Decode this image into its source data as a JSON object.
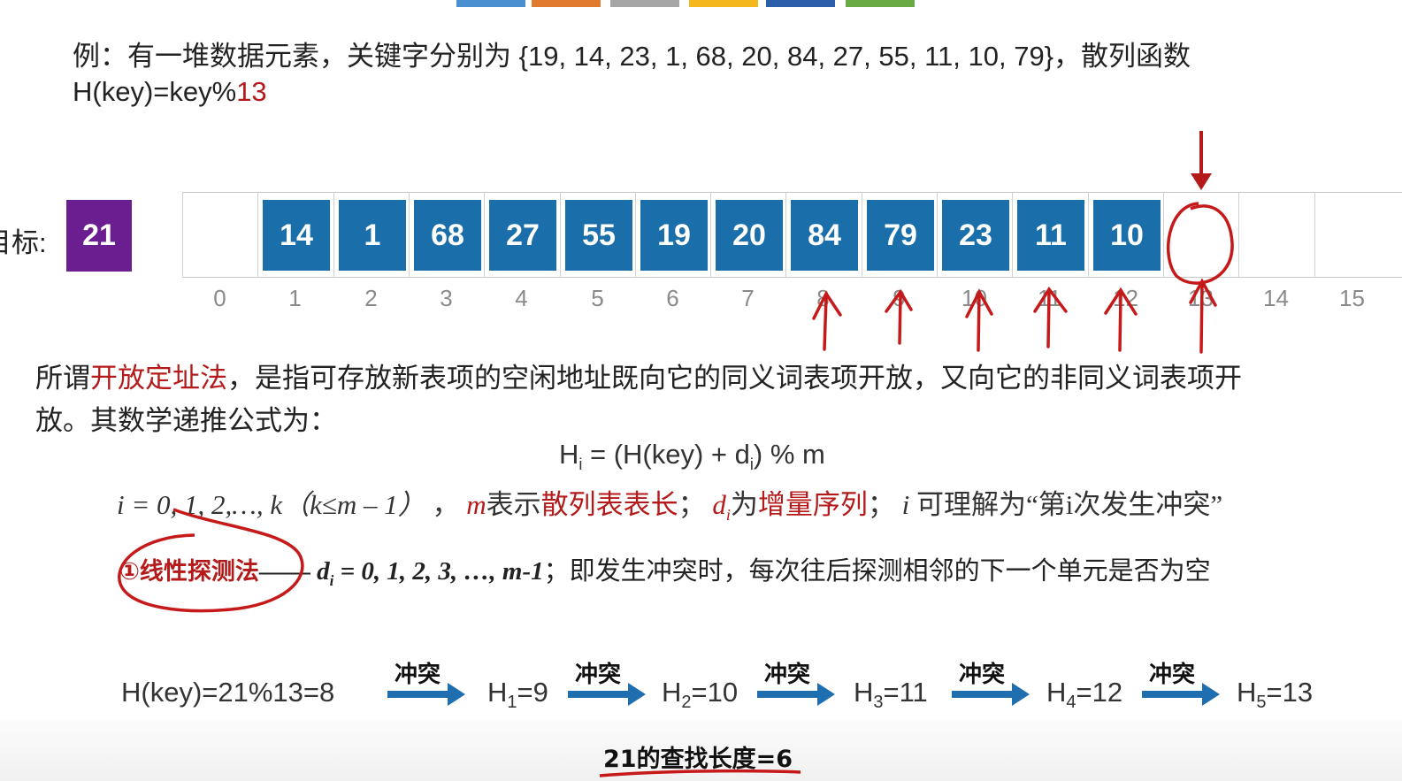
{
  "top_tabs": [
    "#4a8fcf",
    "#e07a2e",
    "#a6a6a6",
    "#f4b81c",
    "#2b5ea8",
    "#6aaa45"
  ],
  "example": {
    "line1_prefix": "例：有一堆数据元素，关键字分别为 {19, 14, 23, 1, 68, 20, 84, 27, 55, 11, 10, 79}，散列函数",
    "line2_prefix": "H(key)=key%",
    "line2_mod": "13"
  },
  "target": {
    "label": "目标:",
    "value": "21"
  },
  "table": {
    "cells": [
      "",
      "14",
      "1",
      "68",
      "27",
      "55",
      "19",
      "20",
      "84",
      "79",
      "23",
      "11",
      "10",
      "",
      "",
      ""
    ],
    "indices": [
      "0",
      "1",
      "2",
      "3",
      "4",
      "5",
      "6",
      "7",
      "8",
      "9",
      "10",
      "11",
      "12",
      "13",
      "14",
      "15"
    ]
  },
  "definition": {
    "line1_a": "所谓",
    "line1_term": "开放定址法",
    "line1_b": "，是指可存放新表项的空闲地址既向它的同义词表项开放，又向它的非同义词表项开",
    "line2": "放。其数学递推公式为："
  },
  "formula": {
    "text": "H",
    "sub_i": "i",
    "rest_a": " = (H(key) + d",
    "rest_b": ") % m"
  },
  "vars": {
    "range": "i = 0, 1, 2,…, k（k≤m – 1）",
    "sep1": "，",
    "m": "m",
    "m_desc_a": "表示",
    "m_desc_b": "散列表表长",
    "sep2": "；",
    "d": "d",
    "d_sub": "i",
    "d_desc_a": "为",
    "d_desc_b": "增量序列",
    "sep3": "；",
    "i": "i",
    "i_desc": " 可理解为“第i次发生冲突”"
  },
  "linear": {
    "title": "①线性探测法",
    "dash": "——",
    "formula_d": "d",
    "formula_sub": "i",
    "formula_rest": " = 0, 1, 2, 3, …, m-1",
    "desc": "；即发生冲突时，每次往后探测相邻的下一个单元是否为空"
  },
  "probe": {
    "start": "H(key)=21%13=8",
    "conflict_label": "冲突",
    "steps": [
      {
        "h": "H",
        "sub": "1",
        "val": "=9"
      },
      {
        "h": "H",
        "sub": "2",
        "val": "=10"
      },
      {
        "h": "H",
        "sub": "3",
        "val": "=11"
      },
      {
        "h": "H",
        "sub": "4",
        "val": "=12"
      },
      {
        "h": "H",
        "sub": "5",
        "val": "=13"
      }
    ]
  },
  "search_length": "21的查找长度=6",
  "colors": {
    "box_blue": "#1a6fab",
    "target_purple": "#6a1e8f",
    "accent_red": "#b41a1a",
    "arrow_blue": "#1f6fb0"
  }
}
